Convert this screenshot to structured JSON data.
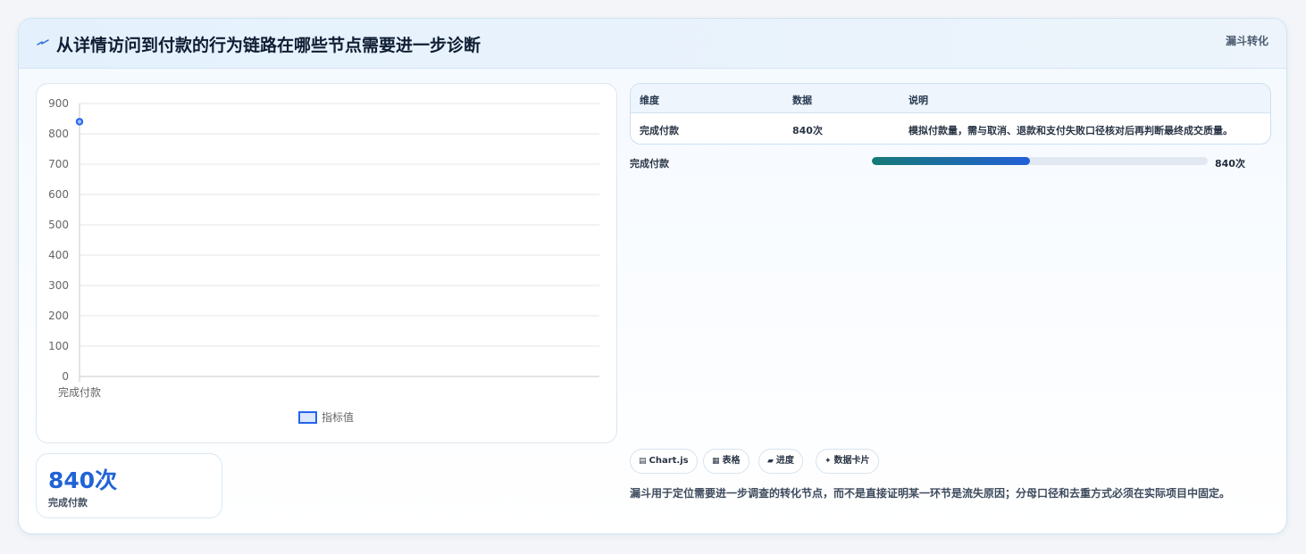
{
  "header": {
    "title": "从详情访问到付款的行为链路在哪些节点需要进一步诊断",
    "badge": "漏斗转化"
  },
  "chart_data": {
    "type": "line",
    "categories": [
      "完成付款"
    ],
    "series": [
      {
        "name": "指标值",
        "values": [
          840
        ]
      }
    ],
    "ylim": [
      0,
      900
    ],
    "yticks": [
      0,
      100,
      200,
      300,
      400,
      500,
      600,
      700,
      800,
      900
    ],
    "grid": true,
    "legend": "bottom",
    "color": "#2563eb"
  },
  "metric": {
    "value": "840次",
    "label": "完成付款"
  },
  "table": {
    "headers": [
      "维度",
      "数据",
      "说明"
    ],
    "rows": [
      [
        "完成付款",
        "840次",
        "模拟付款量，需与取消、退款和支付失败口径核对后再判断最终成交质量。"
      ]
    ]
  },
  "progress": {
    "label": "完成付款",
    "value": "840次",
    "fraction": 0.47
  },
  "chips": [
    {
      "icon": "chart-icon",
      "glyph": "▤",
      "label": "Chart.js"
    },
    {
      "icon": "table-icon",
      "glyph": "▦",
      "label": "表格"
    },
    {
      "icon": "progress-icon",
      "glyph": "▰",
      "label": "进度"
    },
    {
      "icon": "card-icon",
      "glyph": "✦",
      "label": "数据卡片"
    }
  ],
  "note": "漏斗用于定位需要进一步调查的转化节点，而不是直接证明某一环节是流失原因；分母口径和去重方式必须在实际项目中固定。"
}
